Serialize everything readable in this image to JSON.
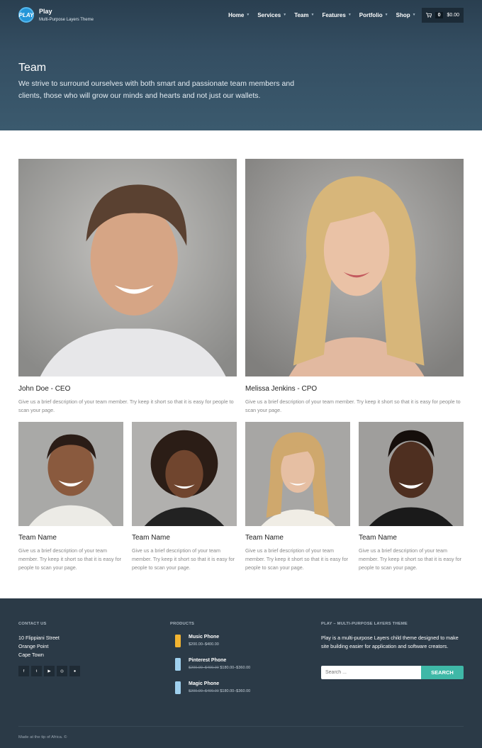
{
  "site": {
    "logo_badge": "PLAY",
    "title": "Play",
    "tagline": "Multi-Purpose Layers Theme"
  },
  "nav": {
    "items": [
      "Home",
      "Services",
      "Team",
      "Features",
      "Portfolio",
      "Shop"
    ],
    "cart_count": "0",
    "cart_total": "$0.00",
    "cart_icon": "cart-icon"
  },
  "hero": {
    "title": "Team",
    "description": "We strive to surround ourselves with both smart and passionate team members and clients, those who will grow our minds and hearts and not just our wallets."
  },
  "team": {
    "featured": [
      {
        "name": "John Doe - CEO",
        "description": "Give us a brief description of your team member. Try keep it short so that it is easy for people to scan your page."
      },
      {
        "name": "Melissa Jenkins - CPO",
        "description": "Give us a brief description of your team member. Try keep it short so that it is easy for people to scan your page."
      }
    ],
    "members": [
      {
        "name": "Team Name",
        "description": "Give us a brief description of your team member. Try keep it short so that it is easy for people to scan your page."
      },
      {
        "name": "Team Name",
        "description": "Give us a brief description of your team member. Try keep it short so that it is easy for people to scan your page."
      },
      {
        "name": "Team Name",
        "description": "Give us a brief description of your team member. Try keep it short so that it is easy for people to scan your page."
      },
      {
        "name": "Team Name",
        "description": "Give us a brief description of your team member. Try keep it short so that it is easy for people to scan your page."
      }
    ]
  },
  "footer": {
    "contact": {
      "heading": "CONTACT US",
      "address": [
        "10 Flippiani Street",
        "Orange Point",
        "Cape Town"
      ],
      "socials": [
        "facebook-icon",
        "twitter-icon",
        "youtube-icon",
        "dribbble-icon",
        "pinterest-icon"
      ]
    },
    "products": {
      "heading": "PRODUCTS",
      "items": [
        {
          "name": "Music Phone",
          "old_price": "",
          "price": "$200.00–$400.00",
          "color": "#f2b431"
        },
        {
          "name": "Pinterest Phone",
          "old_price": "$200.00–$400.00",
          "price": "$180.00–$360.00",
          "color": "#9fd0ee"
        },
        {
          "name": "Magic Phone",
          "old_price": "$200.00–$400.00",
          "price": "$180.00–$360.00",
          "color": "#9fd0ee"
        }
      ]
    },
    "about": {
      "heading": "PLAY – MULTI-PURPOSE LAYERS THEME",
      "text": "Play is a multi-purpose Layers child theme designed to make site building easier for application and software creators."
    },
    "search": {
      "placeholder": "Search ...",
      "button": "SEARCH"
    },
    "copyright": "Made at the tip of Africa. ©"
  },
  "colors": {
    "hero_bg": "#344e62",
    "footer_bg": "#2b3a47",
    "search_button": "#3fb8a7",
    "logo_blue": "#2596d8"
  }
}
